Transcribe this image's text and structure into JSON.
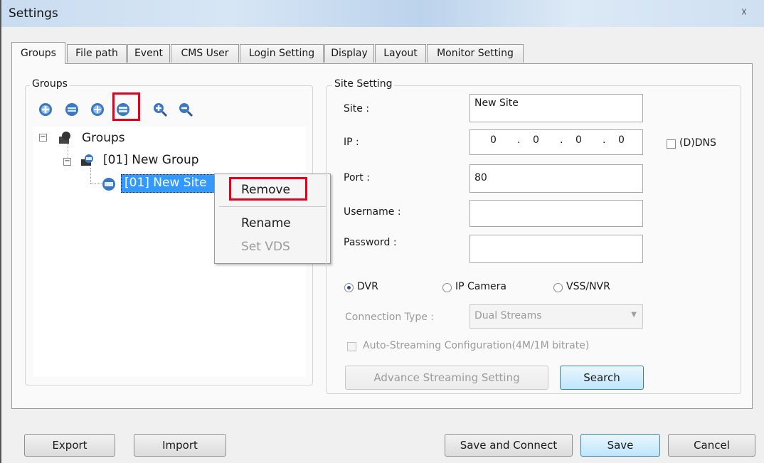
{
  "window": {
    "title": "Settings",
    "close_icon": "close-icon"
  },
  "tabs": [
    {
      "label": "Groups",
      "active": true
    },
    {
      "label": "File path"
    },
    {
      "label": "Event"
    },
    {
      "label": "CMS User"
    },
    {
      "label": "Login Setting"
    },
    {
      "label": "Display"
    },
    {
      "label": "Layout"
    },
    {
      "label": "Monitor Setting"
    }
  ],
  "groups_panel": {
    "legend": "Groups",
    "toolbar_icons": [
      "add-group-icon",
      "add-site-icon",
      "add-device-icon",
      "remove-icon",
      "zoom-in-icon",
      "zoom-out-icon"
    ],
    "tree": {
      "root": "Groups",
      "group": "[01] New Group",
      "site": "[01] New Site"
    }
  },
  "context_menu": {
    "remove": "Remove",
    "rename": "Rename",
    "set_vds": "Set VDS"
  },
  "site_setting": {
    "legend": "Site Setting",
    "site_label": "Site :",
    "site_value": "New Site",
    "ip_label": "IP :",
    "ip_octets": [
      "0",
      "0",
      "0",
      "0"
    ],
    "ddns_label": "(D)DNS",
    "port_label": "Port :",
    "port_value": "80",
    "username_label": "Username :",
    "password_label": "Password :",
    "radio_dvr": "DVR",
    "radio_ipcam": "IP Camera",
    "radio_vss": "VSS/NVR",
    "selected_device_type": "DVR",
    "connection_type_label": "Connection Type :",
    "connection_type_value": "Dual Streams",
    "auto_streaming_label": "Auto-Streaming Configuration(4M/1M bitrate)",
    "advance_button": "Advance Streaming Setting",
    "search_button": "Search"
  },
  "footer": {
    "export": "Export",
    "import": "Import",
    "save_connect": "Save and Connect",
    "save": "Save",
    "cancel": "Cancel"
  },
  "colors": {
    "highlight_red": "#e8001a",
    "tree_selection": "#3399ff",
    "icon_blue": "#3b78c4"
  }
}
